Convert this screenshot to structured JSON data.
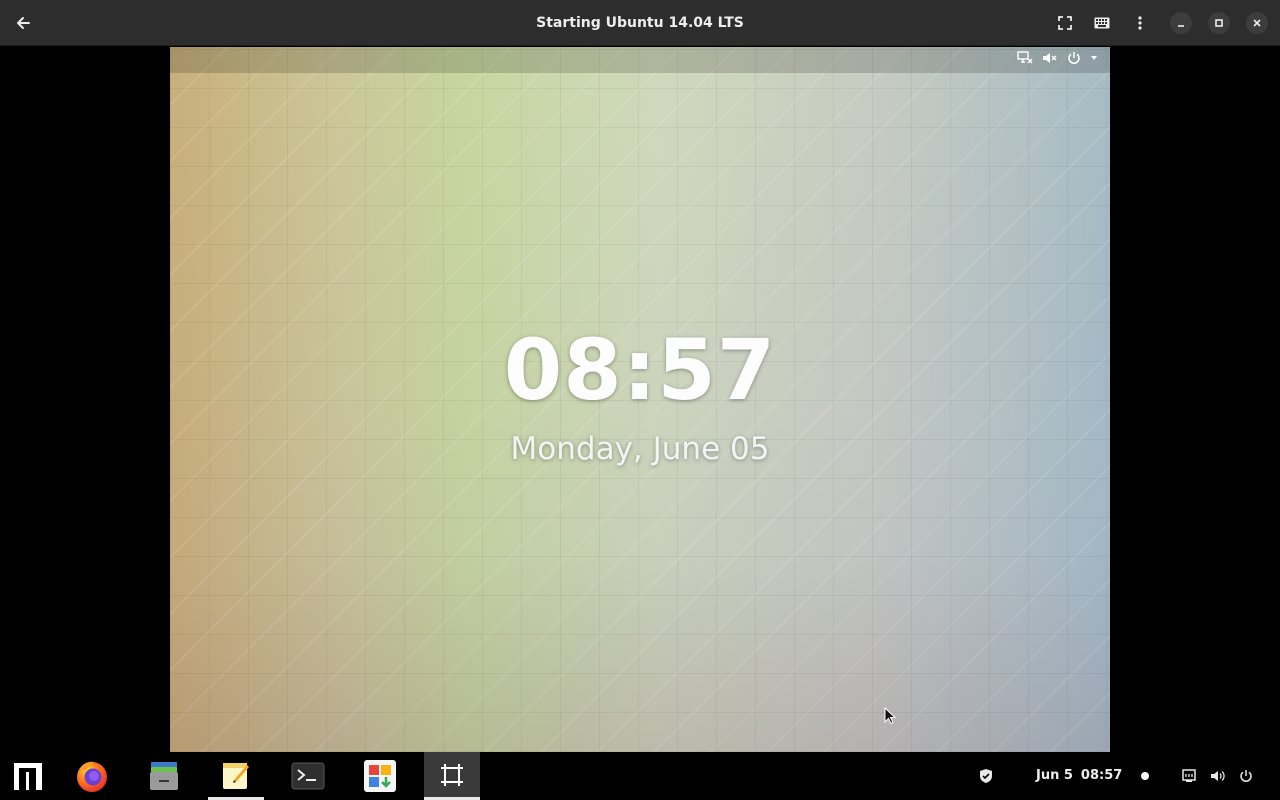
{
  "window": {
    "title": "Starting Ubuntu 14.04 LTS",
    "icons": {
      "back": "back-arrow-icon",
      "fullscreen": "fullscreen-icon",
      "keyboard": "keyboard-icon",
      "menu": "more-vertical-icon",
      "minimize": "minimize-icon",
      "maximize": "maximize-icon",
      "close": "close-icon"
    }
  },
  "vm": {
    "lock_screen": {
      "time": "08:57",
      "date": "Monday, June 05"
    },
    "status_icons": [
      "network-offline-icon",
      "volume-muted-icon",
      "power-icon",
      "dropdown-arrow-icon"
    ]
  },
  "dock": {
    "apps": [
      {
        "name": "menu-launcher-icon",
        "state": "normal"
      },
      {
        "name": "firefox-icon",
        "state": "normal"
      },
      {
        "name": "files-icon",
        "state": "normal"
      },
      {
        "name": "text-editor-icon",
        "state": "running"
      },
      {
        "name": "terminal-icon",
        "state": "normal"
      },
      {
        "name": "software-icon",
        "state": "normal"
      },
      {
        "name": "virtual-machine-icon",
        "state": "focused"
      }
    ],
    "tray": {
      "date": "Jun 5",
      "time": "08:57",
      "icons": [
        "shield-icon",
        "notification-dot-icon",
        "network-wired-icon",
        "volume-icon",
        "power-icon"
      ]
    }
  },
  "colors": {
    "titlebar": "#2d2d2d",
    "dock": "#000000",
    "clock_text": "#fdfdfd"
  }
}
